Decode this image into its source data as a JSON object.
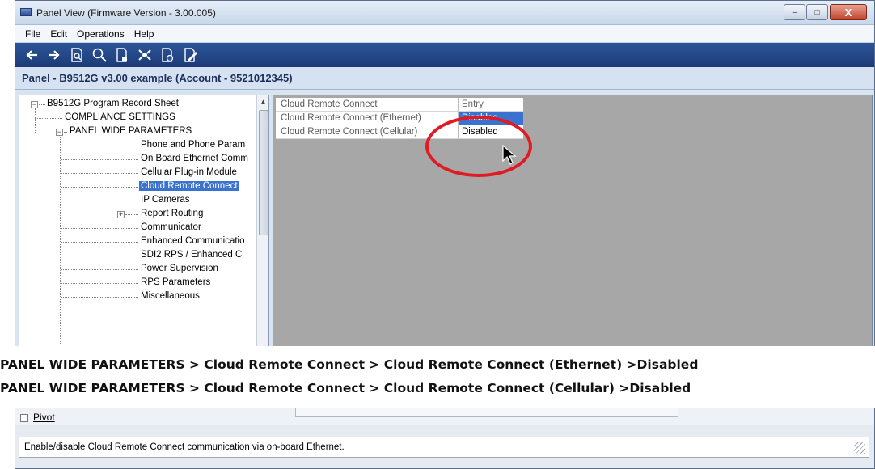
{
  "window": {
    "title": "Panel View (Firmware Version - 3.00.005)",
    "minimize": "–",
    "maximize": "□",
    "close": "X"
  },
  "menu": [
    "File",
    "Edit",
    "Operations",
    "Help"
  ],
  "toolbar_icons": [
    "back-arrow-icon",
    "forward-arrow-icon",
    "find-document-icon",
    "search-icon",
    "lock-document-icon",
    "network-icon",
    "timed-document-icon",
    "edit-document-icon"
  ],
  "panel_header": "Panel - B9512G v3.00 example (Account - 9521012345)",
  "tree": {
    "root": "B9512G Program Record Sheet",
    "items": [
      "COMPLIANCE SETTINGS",
      "PANEL WIDE PARAMETERS",
      "Phone and Phone Param",
      "On Board Ethernet Comm",
      "Cellular Plug-in Module",
      "Cloud Remote Connect",
      "IP Cameras",
      "Report Routing",
      "Communicator",
      "Enhanced Communicatio",
      "SDI2 RPS / Enhanced C",
      "Power Supervision",
      "RPS Parameters",
      "Miscellaneous"
    ],
    "selected": "Cloud Remote Connect"
  },
  "grid": {
    "header_name": "Cloud Remote Connect",
    "header_value": "Entry",
    "rows": [
      {
        "name": "Cloud Remote Connect (Ethernet)",
        "value": "Disabled"
      },
      {
        "name": "Cloud Remote Connect (Cellular)",
        "value": "Disabled"
      }
    ]
  },
  "caption": {
    "line1": "PANEL WIDE PARAMETERS > Cloud Remote Connect > Cloud Remote Connect (Ethernet) >Disabled",
    "line2": "PANEL WIDE PARAMETERS > Cloud Remote Connect > Cloud Remote Connect (Cellular) >Disabled"
  },
  "bottom": {
    "pivot_label": "Pivot",
    "status_text": "Enable/disable Cloud Remote Connect communication via on-board Ethernet."
  },
  "colors": {
    "toolbar_bg": "#2d5599",
    "selection": "#3a73cf",
    "highlight_ellipse": "#e01b24",
    "grid_bg": "#a7a7a7"
  }
}
